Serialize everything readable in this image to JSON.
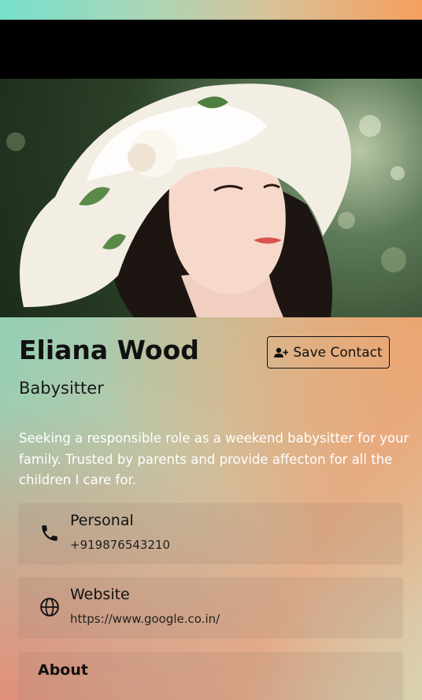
{
  "profile": {
    "name": "Eliana Wood",
    "role": "Babysitter",
    "bio": "Seeking a responsible role as a weekend babysitter for your family. Trusted by parents and provide affecton for all the children I care for."
  },
  "actions": {
    "save_contact_label": "Save Contact",
    "save_contact_icon": "person-add-icon"
  },
  "contacts": [
    {
      "label": "Personal",
      "value": "+919876543210",
      "icon": "phone-icon"
    },
    {
      "label": "Website",
      "value": "https://www.google.co.in/",
      "icon": "globe-icon"
    }
  ],
  "about": {
    "label": "About"
  },
  "colors": {
    "top_gradient": [
      "#77e0cd",
      "#f59f5d"
    ],
    "text": "#111111",
    "bio_text": "#ffffff"
  }
}
